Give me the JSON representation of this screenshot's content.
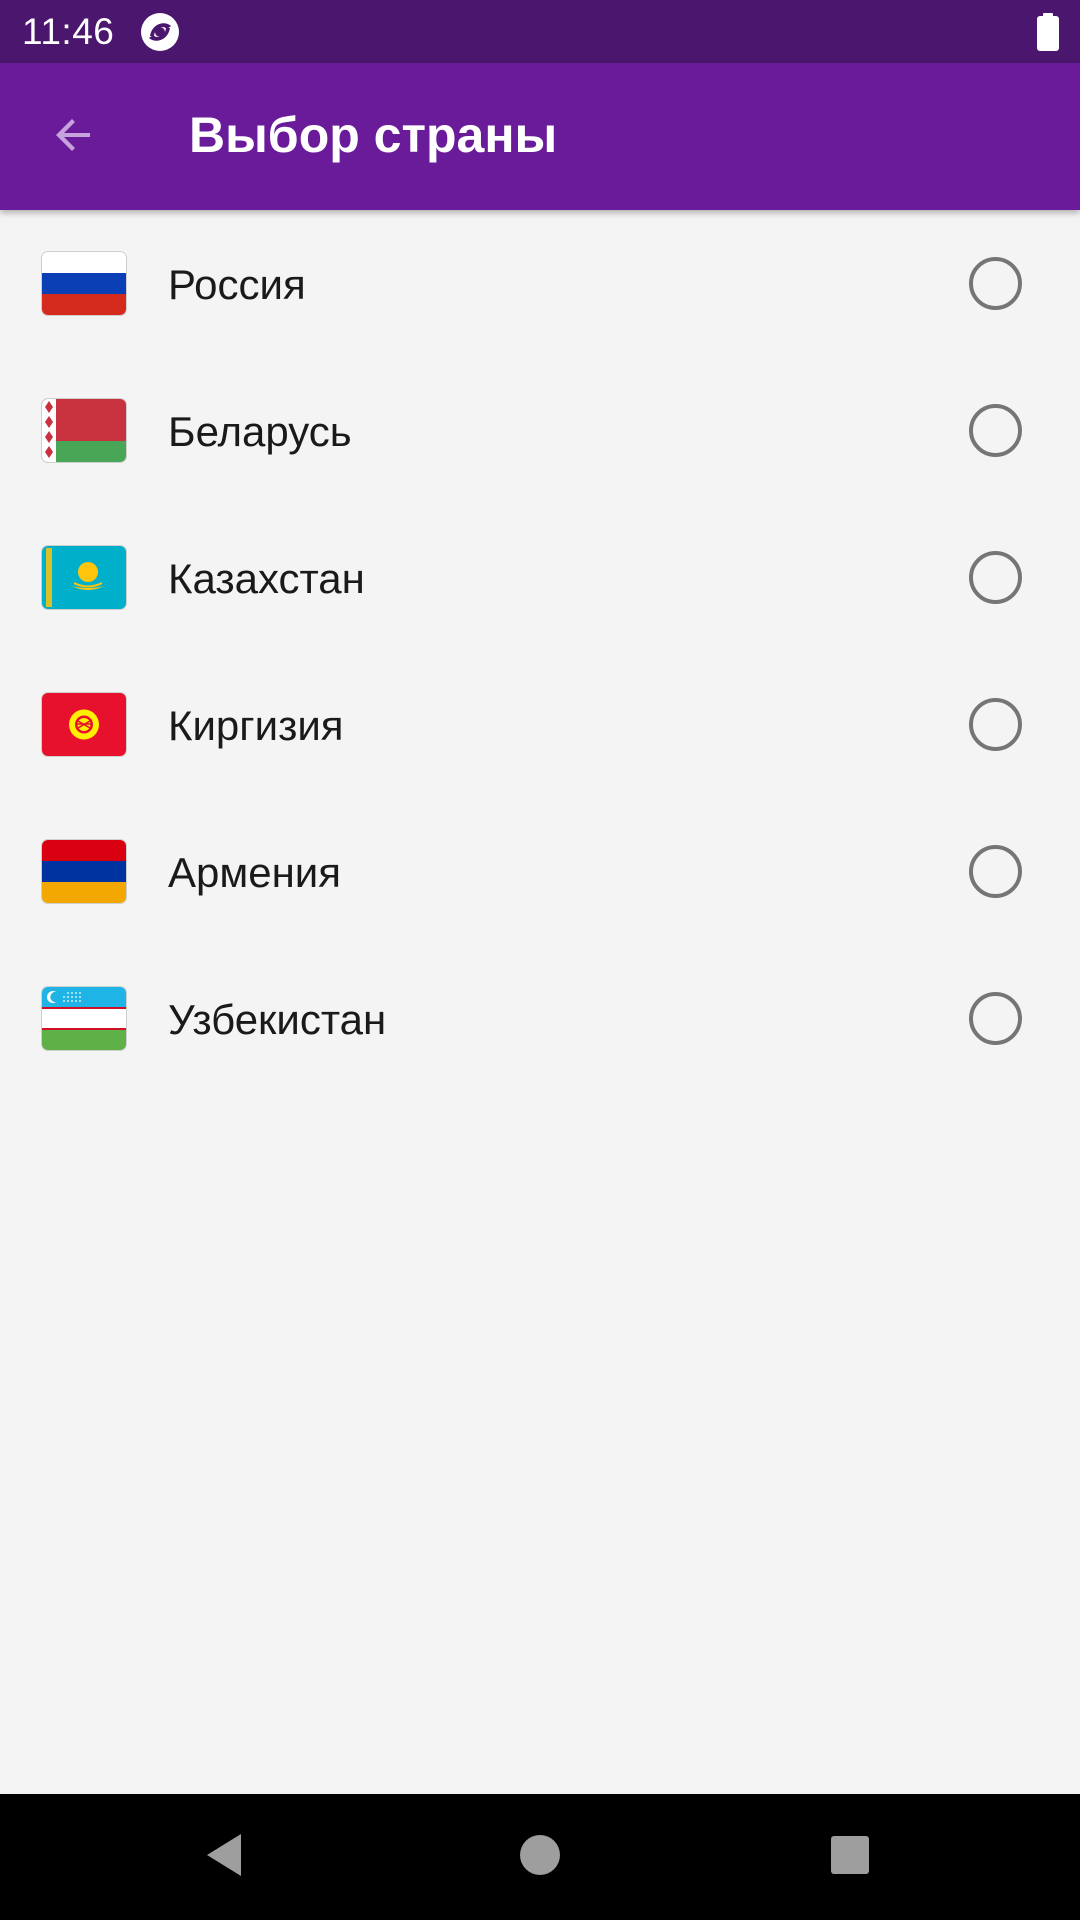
{
  "status_bar": {
    "time": "11:46",
    "app_icon": "app-notification-icon",
    "battery_icon": "battery-icon",
    "background": "#4b176e"
  },
  "app_bar": {
    "back_icon": "arrow-back-icon",
    "title": "Выбор страны",
    "background": "#6a1b9a"
  },
  "countries": [
    {
      "name": "Россия",
      "flag": "russia-flag-icon",
      "selected": false
    },
    {
      "name": "Беларусь",
      "flag": "belarus-flag-icon",
      "selected": false
    },
    {
      "name": "Казахстан",
      "flag": "kazakhstan-flag-icon",
      "selected": false
    },
    {
      "name": "Киргизия",
      "flag": "kyrgyzstan-flag-icon",
      "selected": false
    },
    {
      "name": "Армения",
      "flag": "armenia-flag-icon",
      "selected": false
    },
    {
      "name": "Узбекистан",
      "flag": "uzbekistan-flag-icon",
      "selected": false
    }
  ],
  "nav_bar": {
    "back": "nav-back-icon",
    "home": "nav-home-icon",
    "recents": "nav-recents-icon"
  }
}
